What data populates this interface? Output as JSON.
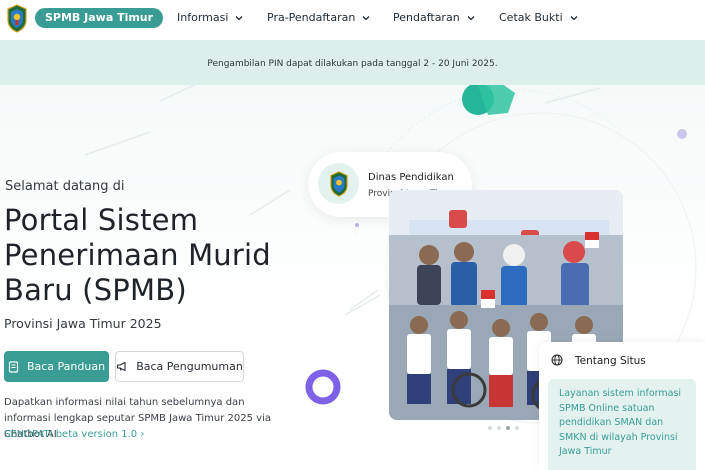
{
  "header": {
    "brand": "SPMB Jawa Timur",
    "nav": [
      {
        "label": "Informasi"
      },
      {
        "label": "Pra-Pendaftaran"
      },
      {
        "label": "Pendaftaran"
      },
      {
        "label": "Cetak Bukti"
      }
    ]
  },
  "announcement": "Pengambilan PIN dapat dilakukan pada tanggal 2 - 20 Juni 2025.",
  "hero": {
    "welcome": "Selamat datang di",
    "title": "Portal Sistem Penerimaan Murid Baru (SPMB)",
    "subtitle": "Provinsi Jawa Timur 2025",
    "btn_primary": "Baca Panduan",
    "btn_secondary": "Baca Pengumuman",
    "description": "Dapatkan informasi nilai tahun sebelumnya dan informasi lengkap seputar SPMB Jawa Timur 2025 via Chatbot AI",
    "senopati": "SENOPATI beta version 1.0",
    "senopati_arrow": "›"
  },
  "dinas": {
    "name": "Dinas Pendidikan",
    "sub": "Provinsi Jawa Timur"
  },
  "carousel": {
    "active_index": 3,
    "count": 4
  },
  "about": {
    "title": "Tentang Situs",
    "text": "Layanan sistem informasi SPMB Online satuan pendidikan SMAN dan SMKN di wilayah Provinsi Jawa Timur"
  },
  "colors": {
    "accent": "#3a9d95",
    "announce_bg": "#dcefeb",
    "about_bg": "#e3f2ef"
  },
  "icons": {
    "logo": "jawa-timur-crest-icon",
    "chevron": "chevron-down-icon",
    "book": "book-icon",
    "megaphone": "megaphone-icon",
    "globe": "globe-icon"
  }
}
